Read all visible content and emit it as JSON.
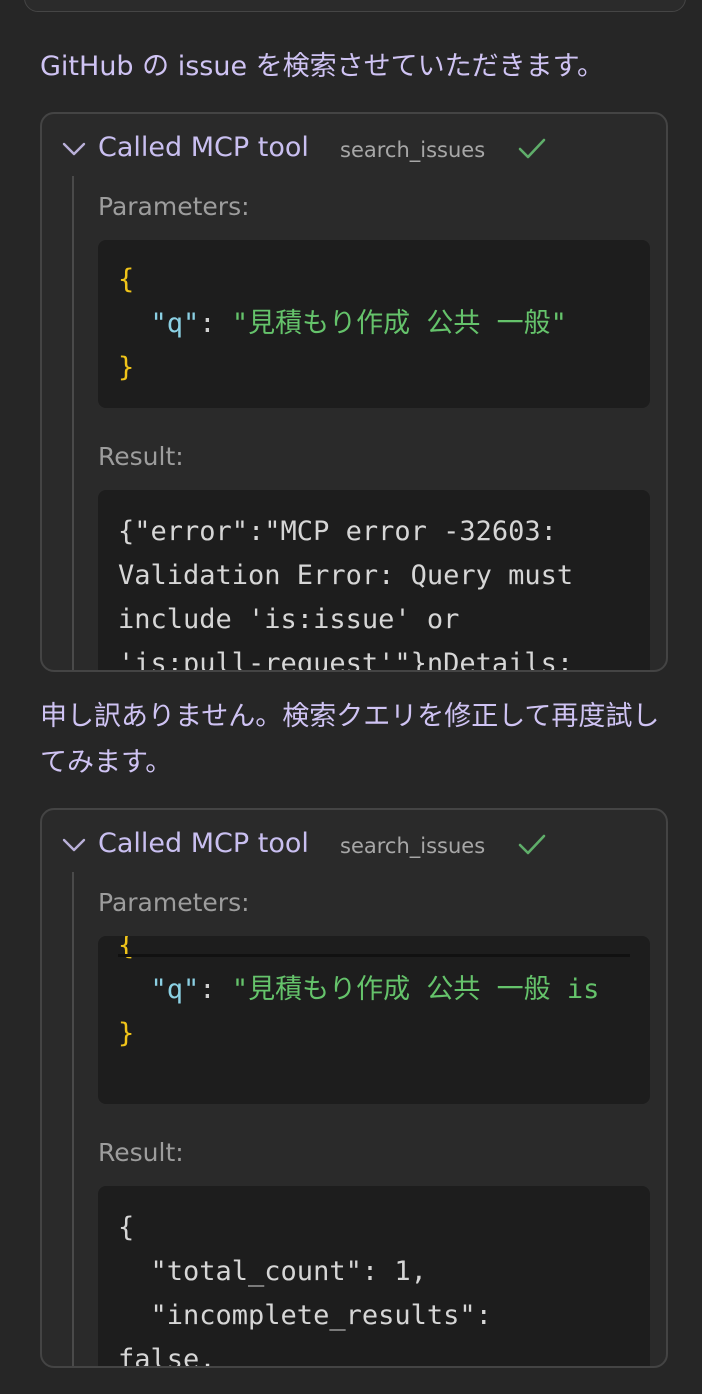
{
  "messages": {
    "intro": "GitHub の issue を検索させていただきます。",
    "retry": "申し訳ありません。検索クエリを修正して再度試してみます。"
  },
  "tool_calls": [
    {
      "label": "Called MCP tool",
      "tool": "search_issues",
      "parameters_label": "Parameters:",
      "params": {
        "open_brace": "{",
        "key": "\"q\"",
        "colon": ": ",
        "value": "\"見積もり作成 公共 一般\"",
        "close_brace": "}"
      },
      "result_label": "Result:",
      "result_lines": [
        "{\"error\":\"MCP error -32603:",
        "Validation Error: Query must",
        "include 'is:issue' or",
        "'is:pull-request'\"}nDetails:"
      ]
    },
    {
      "label": "Called MCP tool",
      "tool": "search_issues",
      "parameters_label": "Parameters:",
      "params": {
        "open_brace": "{",
        "key": "\"q\"",
        "colon": ": ",
        "value": "\"見積もり作成 公共 一般 is",
        "close_brace": "}"
      },
      "result_label": "Result:",
      "result_lines": [
        "{",
        "  \"total_count\": 1,",
        "  \"incomplete_results\":",
        "false,"
      ]
    }
  ],
  "colors": {
    "background": "#262626",
    "message_text": "#cfc3f3",
    "check": "#5fae6a",
    "brace": "#f0c419",
    "key": "#8bd0e3",
    "string": "#65c36b"
  },
  "icons": [
    "chevron-down-icon",
    "check-icon"
  ]
}
